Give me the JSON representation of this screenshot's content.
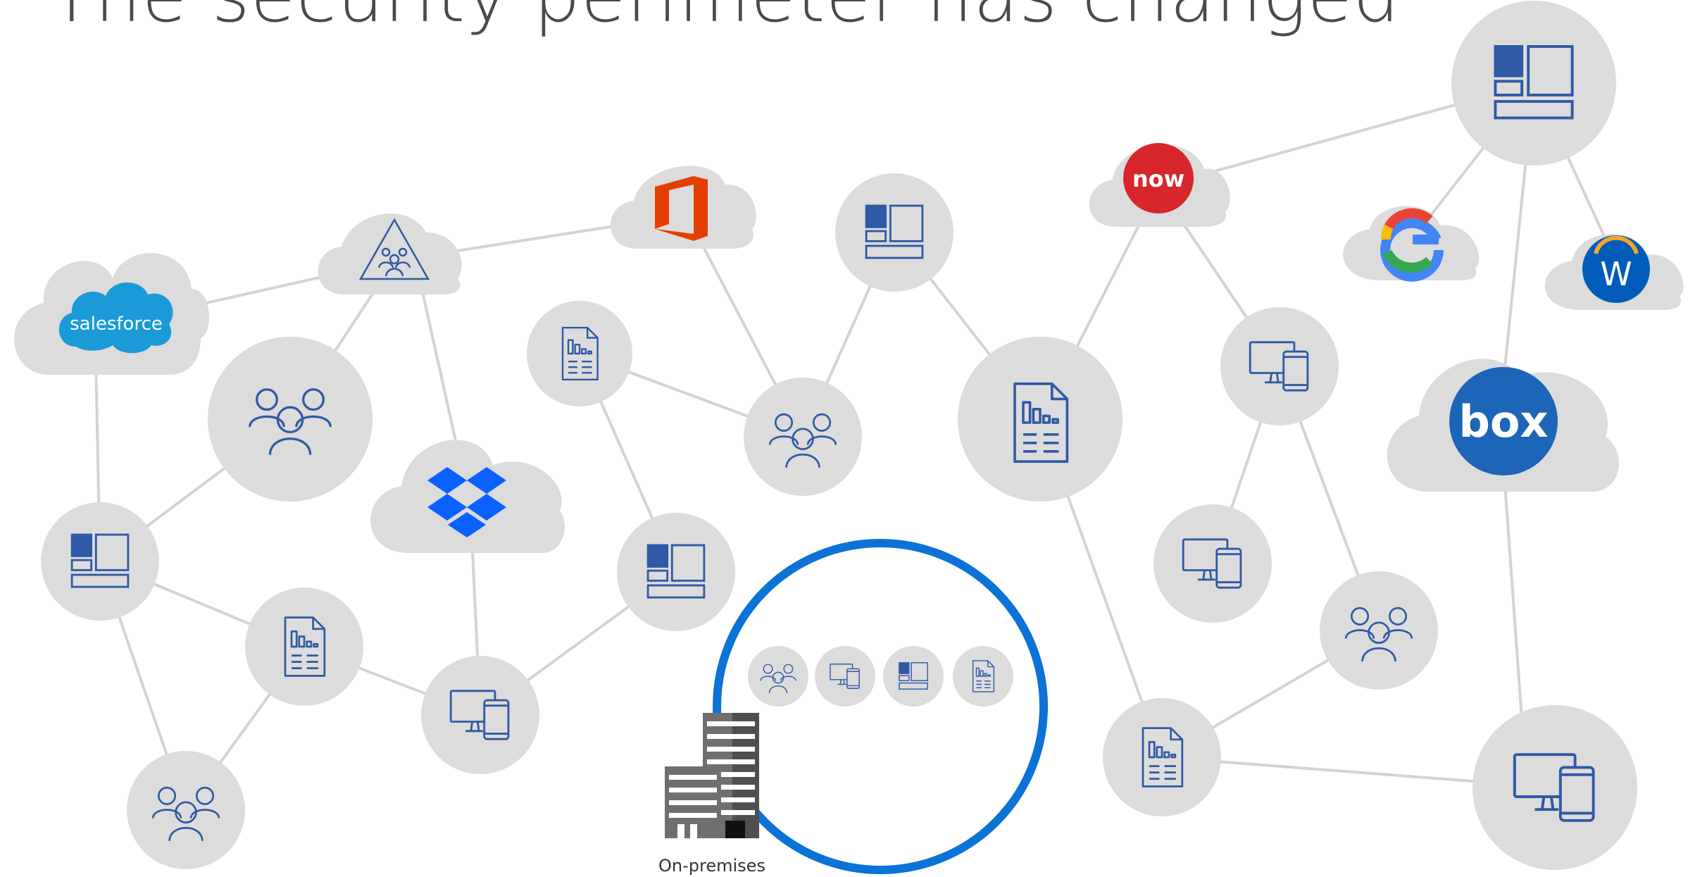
{
  "title": "The security perimeter has changed",
  "brands": {
    "salesforce": "salesforce",
    "servicenow": "now",
    "box": "box",
    "workday": "W"
  },
  "on_premises_label": "On-premises",
  "colors": {
    "bubble": "#dcdcdc",
    "line": "#d3d3d3",
    "icon_blue": "#2f5aa5",
    "ring_blue": "#0b72d6",
    "salesforce": "#1a9bd7",
    "office": "#e43e00",
    "servicenow": "#d7262c",
    "box": "#1c65b8",
    "dropbox": "#0b61ff",
    "workday_bg": "#005cb9",
    "workday_arc": "#f5a623"
  },
  "icons": {
    "people": "people-icon",
    "app": "app-layout-icon",
    "document": "report-document-icon",
    "devices": "devices-icon",
    "building": "building-icon",
    "sharepoint": "sharepoint-triangle-icon"
  }
}
